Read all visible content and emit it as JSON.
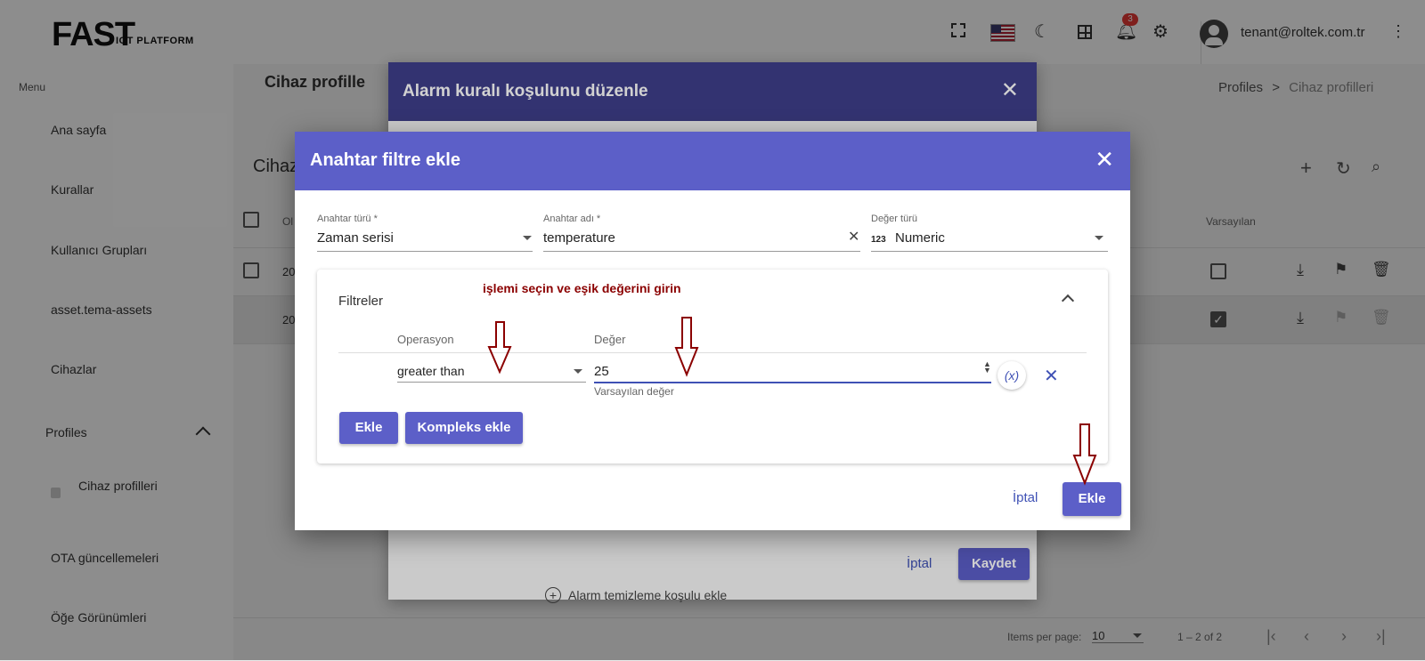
{
  "logo": {
    "main": "FAST",
    "sub": "IOT PLATFORM"
  },
  "sidebar": {
    "menu_label": "Menu",
    "items": [
      {
        "label": "Ana sayfa"
      },
      {
        "label": "Kurallar"
      },
      {
        "label": "Kullanıcı Grupları"
      },
      {
        "label": "asset.tema-assets"
      },
      {
        "label": "Cihazlar"
      },
      {
        "label": "Profiles"
      },
      {
        "label": "Cihaz profilleri"
      },
      {
        "label": "OTA güncellemeleri"
      },
      {
        "label": "Öğe Görünümleri"
      }
    ]
  },
  "topbar": {
    "notification_count": "3",
    "user_email": "tenant@roltek.com.tr"
  },
  "page": {
    "title_partial": "Cihaz profille",
    "section_partial": "Cihaz",
    "breadcrumb_root": "Profiles",
    "breadcrumb_sep": ">",
    "breadcrumb_current": "Cihaz profilleri",
    "col_default": "Varsayılan",
    "col_partial": "Ol",
    "row1_partial": "20",
    "row2_partial": "20",
    "items_per_page_label": "Items per page:",
    "items_per_page_value": "10",
    "range": "1 – 2 of 2"
  },
  "back_dialog": {
    "title": "Alarm kuralı koşulunu düzenle",
    "cancel": "İptal",
    "save": "Kaydet",
    "clear_condition": "Alarm temizleme koşulu ekle"
  },
  "dialog": {
    "title": "Anahtar filtre ekle",
    "key_type": {
      "label": "Anahtar türü *",
      "value": "Zaman serisi"
    },
    "key_name": {
      "label": "Anahtar adı *",
      "value": "temperature"
    },
    "value_type": {
      "label": "Değer türü",
      "prefix": "123",
      "value": "Numeric"
    },
    "filters": {
      "title": "Filtreler",
      "col_operation": "Operasyon",
      "col_value": "Değer",
      "operation": "greater than",
      "value": "25",
      "value_hint": "Varsayılan değer",
      "dynamic_label": "(x)",
      "add": "Ekle",
      "add_complex": "Kompleks ekle"
    },
    "cancel": "İptal",
    "submit": "Ekle"
  },
  "annotation": {
    "text": "işlemi seçin ve eşik değerini girin",
    "color": "#8b0000"
  },
  "colors": {
    "accent": "#5c5fc8",
    "header_dark": "#3f3f8a"
  }
}
